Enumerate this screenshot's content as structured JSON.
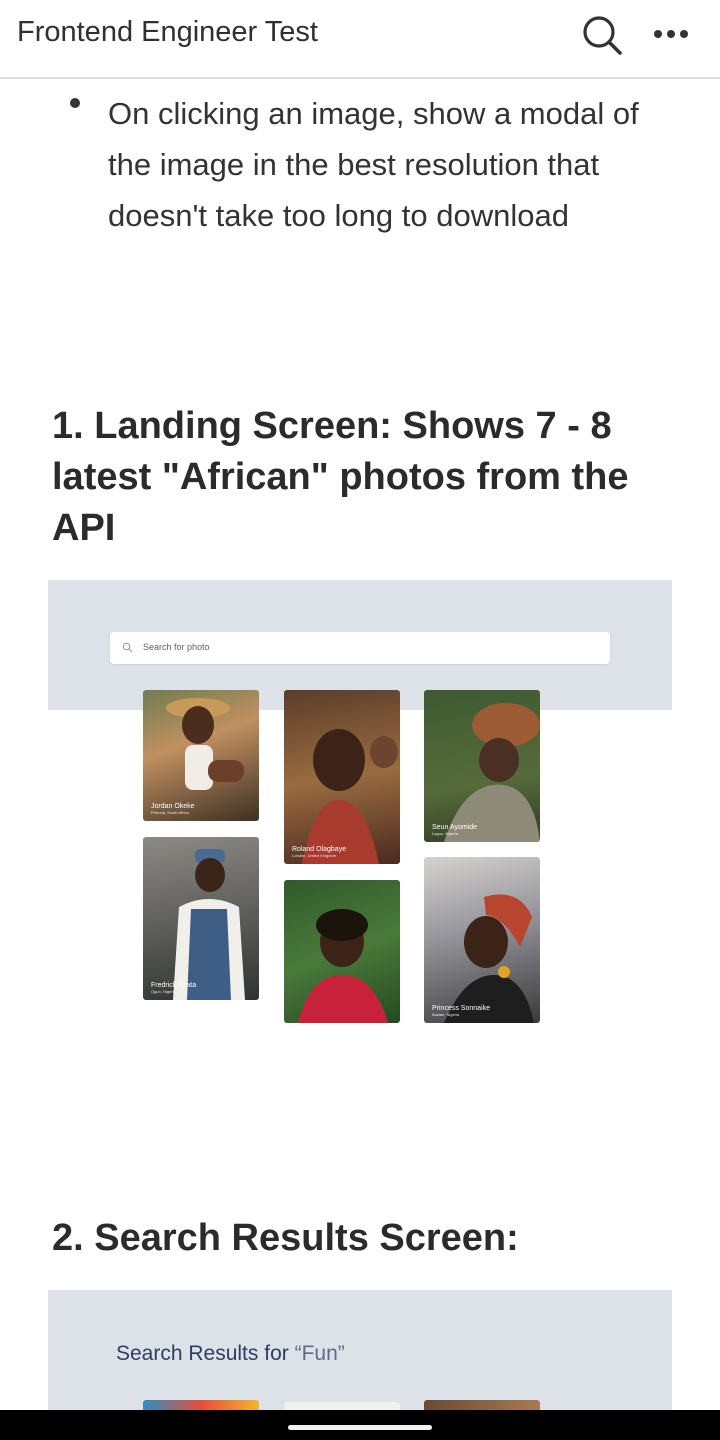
{
  "appbar": {
    "title": "Frontend Engineer Test",
    "search_icon": "search-icon",
    "more_icon": "more-horizontal-icon"
  },
  "bullet": {
    "text": "On clicking an image, show a modal of the image in the best resolution that doesn't take too long to download"
  },
  "sections": {
    "landing_title": "1. Landing Screen: Shows 7 - 8 latest \"African\" photos from the API",
    "search_title": "2. Search Results Screen:"
  },
  "landing_mock": {
    "search_placeholder": "Search for photo",
    "cards": [
      {
        "name": "Jordan Okeke",
        "location": "Pretoria, South Africa"
      },
      {
        "name": "Roland Olagbaye",
        "location": "London, United Kingdom"
      },
      {
        "name": "Seun Ayomide",
        "location": "Lagos, Nigeria"
      },
      {
        "name": "Fredrick Apata",
        "location": "Ogun, Nigeria"
      },
      {
        "name": "",
        "location": ""
      },
      {
        "name": "Princess Sonnaike",
        "location": "Ibadan, Nigeria"
      }
    ]
  },
  "search_mock": {
    "results_prefix": "Search Results for ",
    "results_query": "“Fun”"
  },
  "colors": {
    "mock_background": "#dde2e9",
    "results_text": "#2d3e64"
  }
}
